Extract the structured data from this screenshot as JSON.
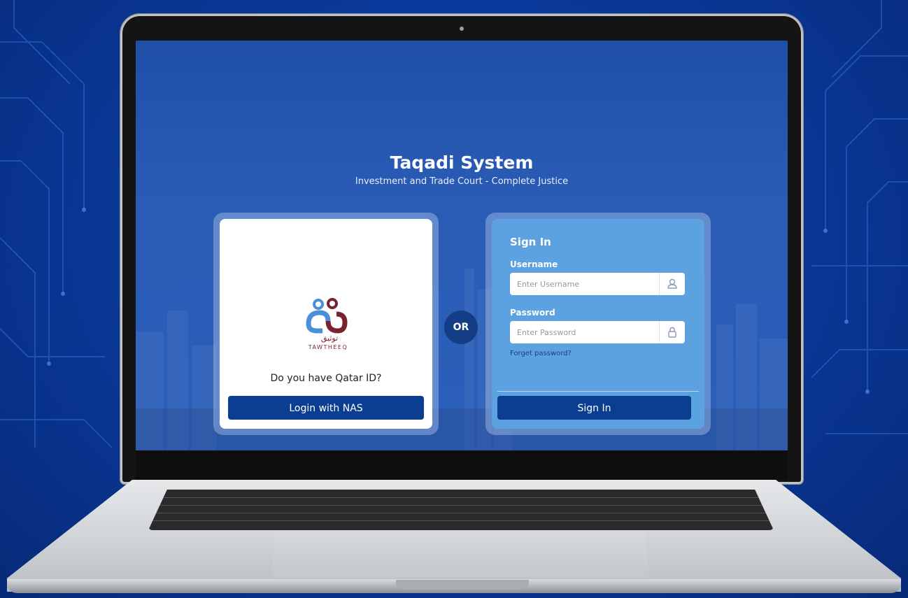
{
  "app": {
    "title": "Taqadi System",
    "subtitle": "Investment and Trade Court - Complete Justice"
  },
  "nas_card": {
    "logo_arabic": "توثيق",
    "logo_latin": "TAWTHEEQ",
    "question": "Do you have Qatar ID?",
    "button_label": "Login with NAS"
  },
  "separator": {
    "label": "OR"
  },
  "signin_card": {
    "heading": "Sign In",
    "username_label": "Username",
    "username_placeholder": "Enter Username",
    "password_label": "Password",
    "password_placeholder": "Enter Password",
    "forgot_link": "Forget password?",
    "button_label": "Sign In"
  },
  "icons": {
    "username_icon": "user-icon",
    "password_icon": "lock-icon"
  },
  "colors": {
    "primary_button": "#0b3d91",
    "signin_card": "#5da2e0",
    "screen_bg": "#2a5cb6"
  }
}
